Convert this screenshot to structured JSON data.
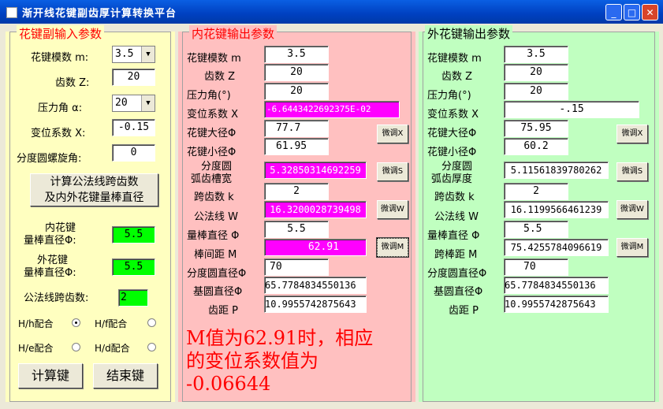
{
  "window": {
    "title": "渐开线花键副齿厚计算转换平台",
    "minimize": "_",
    "maximize": "□",
    "close": "✕"
  },
  "input": {
    "legend": "花键副输入参数",
    "module_label": "花键模数 m:",
    "module_value": "3.5",
    "teeth_label": "齿数 Z:",
    "teeth_value": "20",
    "pressure_label": "压力角 α:",
    "pressure_value": "20",
    "shift_label": "变位系数 X:",
    "shift_value": "-0.15",
    "helix_label": "分度圆螺旋角:",
    "helix_value": "0",
    "calc_button_line1": "计算公法线跨齿数",
    "calc_button_line2": "及内外花键量棒直径",
    "inner_rod_line1": "内花键",
    "inner_rod_line2": "量棒直径Φ:",
    "inner_rod_value": "5.5",
    "outer_rod_line1": "外花键",
    "outer_rod_line2": "量棒直径Φ:",
    "outer_rod_value": "5.5",
    "span_label": "公法线跨齿数:",
    "span_value": "2",
    "fit_hh": "H/h配合",
    "fit_hf": "H/f配合",
    "fit_he": "H/e配合",
    "fit_hd": "H/d配合",
    "compute_button": "计算键",
    "exit_button": "结束键"
  },
  "inner": {
    "legend": "内花键输出参数",
    "labels": [
      "花键模数 m",
      "齿数 Z",
      "压力角(°)",
      "变位系数 X",
      "花键大径Φ",
      "花键小径Φ",
      "分度圆",
      "弧齿槽宽",
      "跨齿数 k",
      "公法线 W",
      "量棒直径 Φ",
      "棒间距 M",
      "分度圆直径Φ",
      "基圆直径Φ",
      "齿距 P"
    ],
    "values": [
      "3.5",
      "20",
      "20",
      "-6.6443422692375E-02",
      "77.7",
      "61.95",
      "5.32850314692259",
      "2",
      "16.3200028739498",
      "5.5",
      "62.91",
      "70",
      "65.7784834550136",
      "10.9955742875643"
    ],
    "adjust_buttons": [
      "微调X",
      "微调S",
      "微调W",
      "微调M"
    ]
  },
  "outer": {
    "legend": "外花键输出参数",
    "labels": [
      "花键模数 m",
      "齿数 Z",
      "压力角(°)",
      "变位系数 X",
      "花键大径Φ",
      "花键小径Φ",
      "分度圆",
      "弧齿厚度",
      "跨齿数 k",
      "公法线 W",
      "量棒直径 Φ",
      "跨棒距 M",
      "分度圆直径Φ",
      "基圆直径Φ",
      "齿距 P"
    ],
    "values": [
      "3.5",
      "20",
      "20",
      "-.15",
      "75.95",
      "60.2",
      "5.11561839780262",
      "2",
      "16.1199566461239",
      "5.5",
      "75.4255784096619",
      "70",
      "65.7784834550136",
      "10.9955742875643"
    ],
    "adjust_buttons": [
      "微调X",
      "微调S",
      "微调W",
      "微调M"
    ]
  },
  "result": {
    "line1": "M值为62.91时，相应",
    "line2": "的变位系数值为",
    "line3": "-0.06644"
  },
  "colors": {
    "input_bg": "#ffffc0",
    "inner_bg": "#ffc0c0",
    "outer_bg": "#c0ffc0",
    "highlight": "#ff00ff",
    "rod": "#00ff00",
    "result_text": "#ff0000"
  }
}
